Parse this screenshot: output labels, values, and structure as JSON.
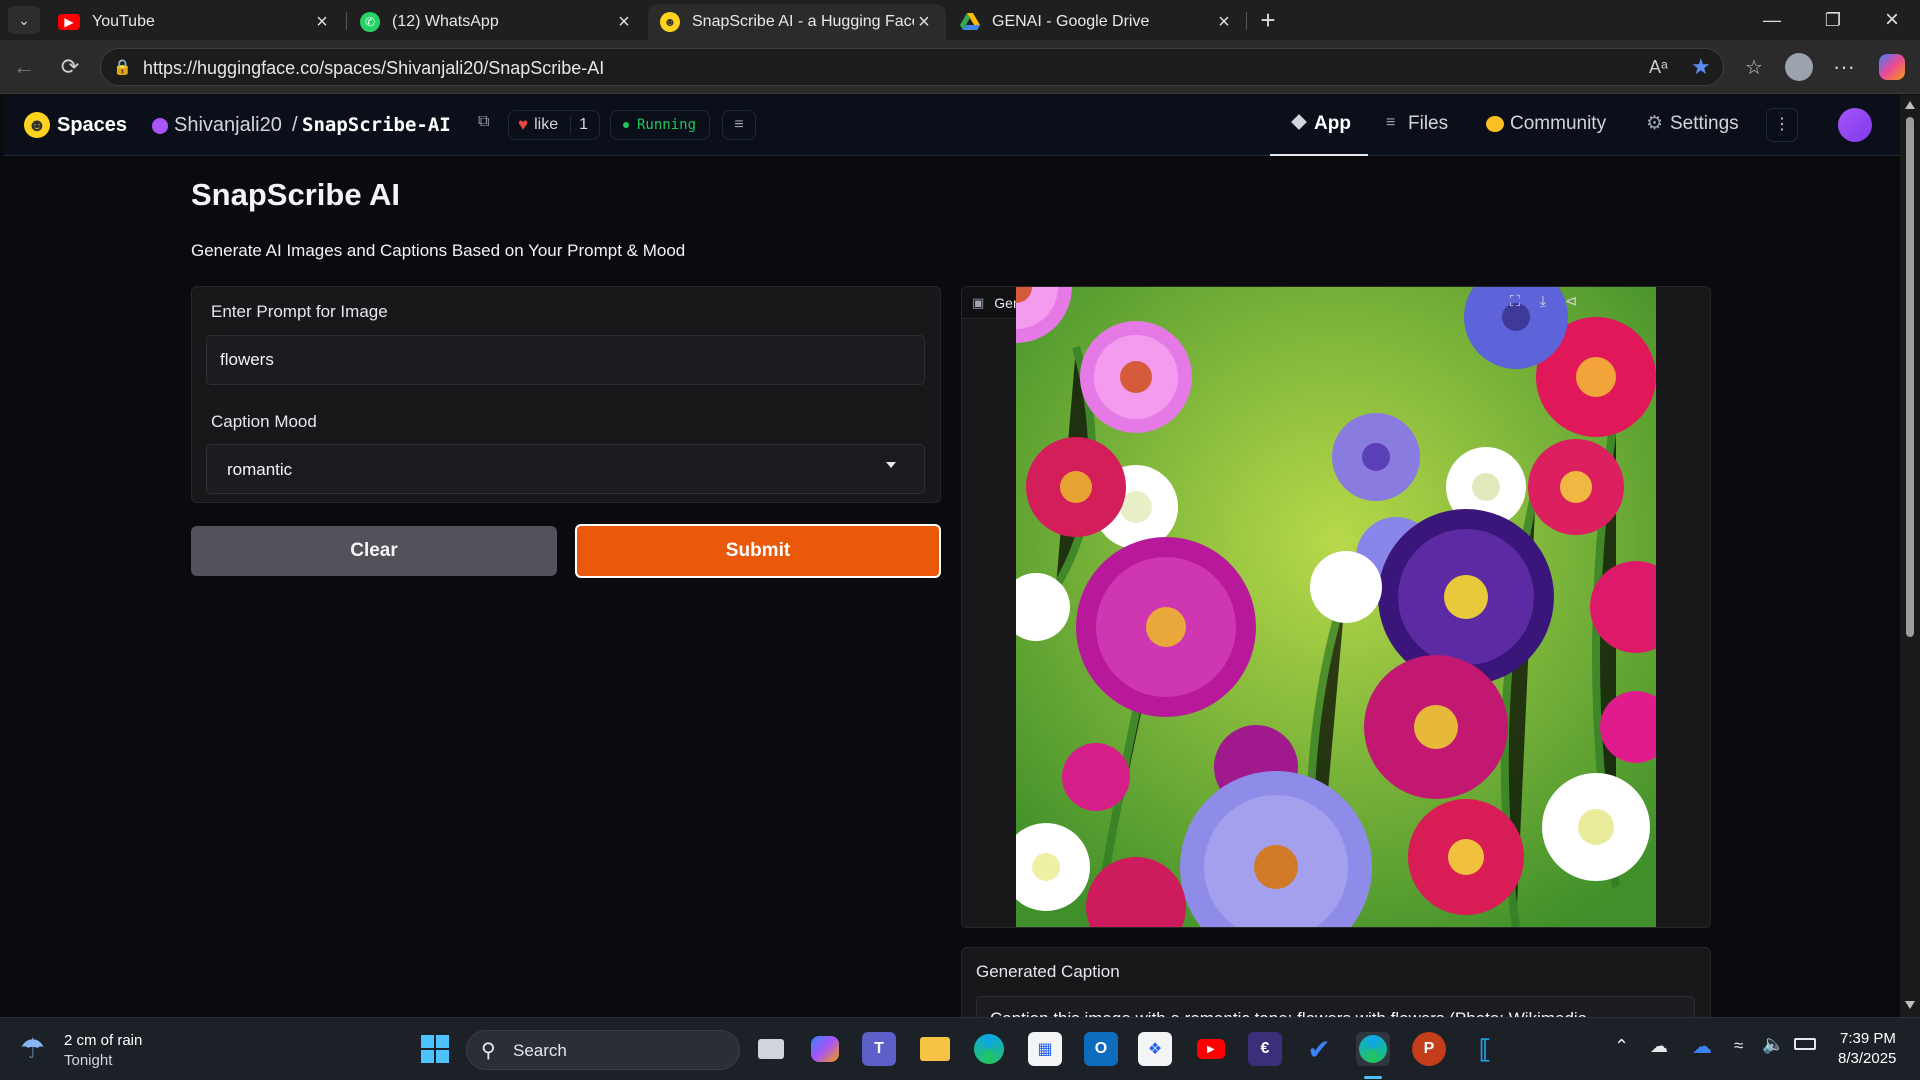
{
  "browser": {
    "tabs": [
      {
        "title": "YouTube",
        "icon": "youtube-icon"
      },
      {
        "title": "(12) WhatsApp",
        "icon": "whatsapp-icon"
      },
      {
        "title": "SnapScribe AI - a Hugging Face Space",
        "icon": "hugging-face-icon",
        "active": true
      },
      {
        "title": "GENAI - Google Drive",
        "icon": "google-drive-icon"
      }
    ],
    "url": "https://huggingface.co/spaces/Shivanjali20/SnapScribe-AI",
    "read_aloud_label": "Aᵃ"
  },
  "hf_header": {
    "spaces_label": "Spaces",
    "owner": "Shivanjali20",
    "separator": "/",
    "repo": "SnapScribe-AI",
    "like_label": "like",
    "like_count": "1",
    "status": "Running",
    "nav": [
      {
        "label": "App",
        "icon": "cube-icon",
        "active": true
      },
      {
        "label": "Files",
        "icon": "files-icon"
      },
      {
        "label": "Community",
        "icon": "community-icon"
      },
      {
        "label": "Settings",
        "icon": "gear-icon"
      }
    ]
  },
  "app": {
    "title": "SnapScribe AI",
    "subtitle": "Generate AI Images and Captions Based on Your Prompt & Mood",
    "prompt_label": "Enter Prompt for Image",
    "prompt_value": "flowers",
    "mood_label": "Caption Mood",
    "mood_value": "romantic",
    "clear_label": "Clear",
    "submit_label": "Submit",
    "image_label": "Generated Image",
    "caption_label": "Generated Caption",
    "caption_value": "Caption this image with a romantic tone: flowers with flowers (Photo: Wikimedia"
  },
  "colors": {
    "accent": "#ea580c",
    "status_green": "#22c55e",
    "panel": "#18181b",
    "clear_btn": "#52525b"
  },
  "taskbar": {
    "weather_line1": "2 cm of rain",
    "weather_line2": "Tonight",
    "search_placeholder": "Search",
    "time": "7:39 PM",
    "date": "8/3/2025"
  }
}
